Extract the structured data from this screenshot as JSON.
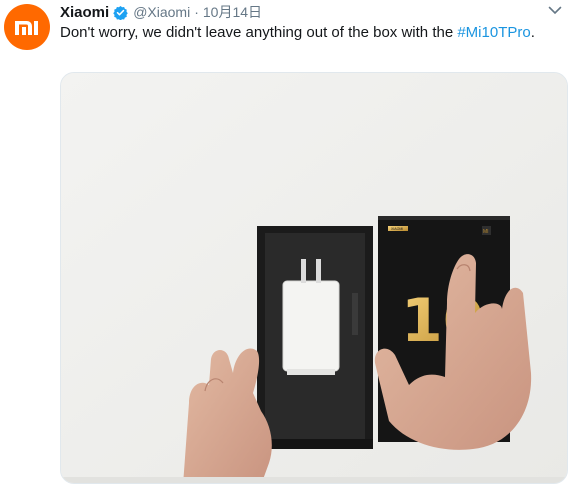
{
  "tweet": {
    "author_name": "Xiaomi",
    "handle": "@Xiaomi",
    "separator": "·",
    "timestamp": "10月14日",
    "text_before": "Don't worry, we didn't leave anything out of the box with the ",
    "hashtag": "#Mi10TPro",
    "text_after": ".",
    "avatar_icon": "mi-logo-icon",
    "verified_icon": "verified-badge-icon",
    "menu_icon": "chevron-down-icon"
  },
  "media": {
    "box_lid_text": "10",
    "box_label": "XIAOMI",
    "box_corner_mark": "MI"
  },
  "colors": {
    "brand": "#ff6900",
    "verified": "#1da1f2",
    "link": "#1b95e0",
    "text": "#14171a",
    "muted": "#657786"
  }
}
